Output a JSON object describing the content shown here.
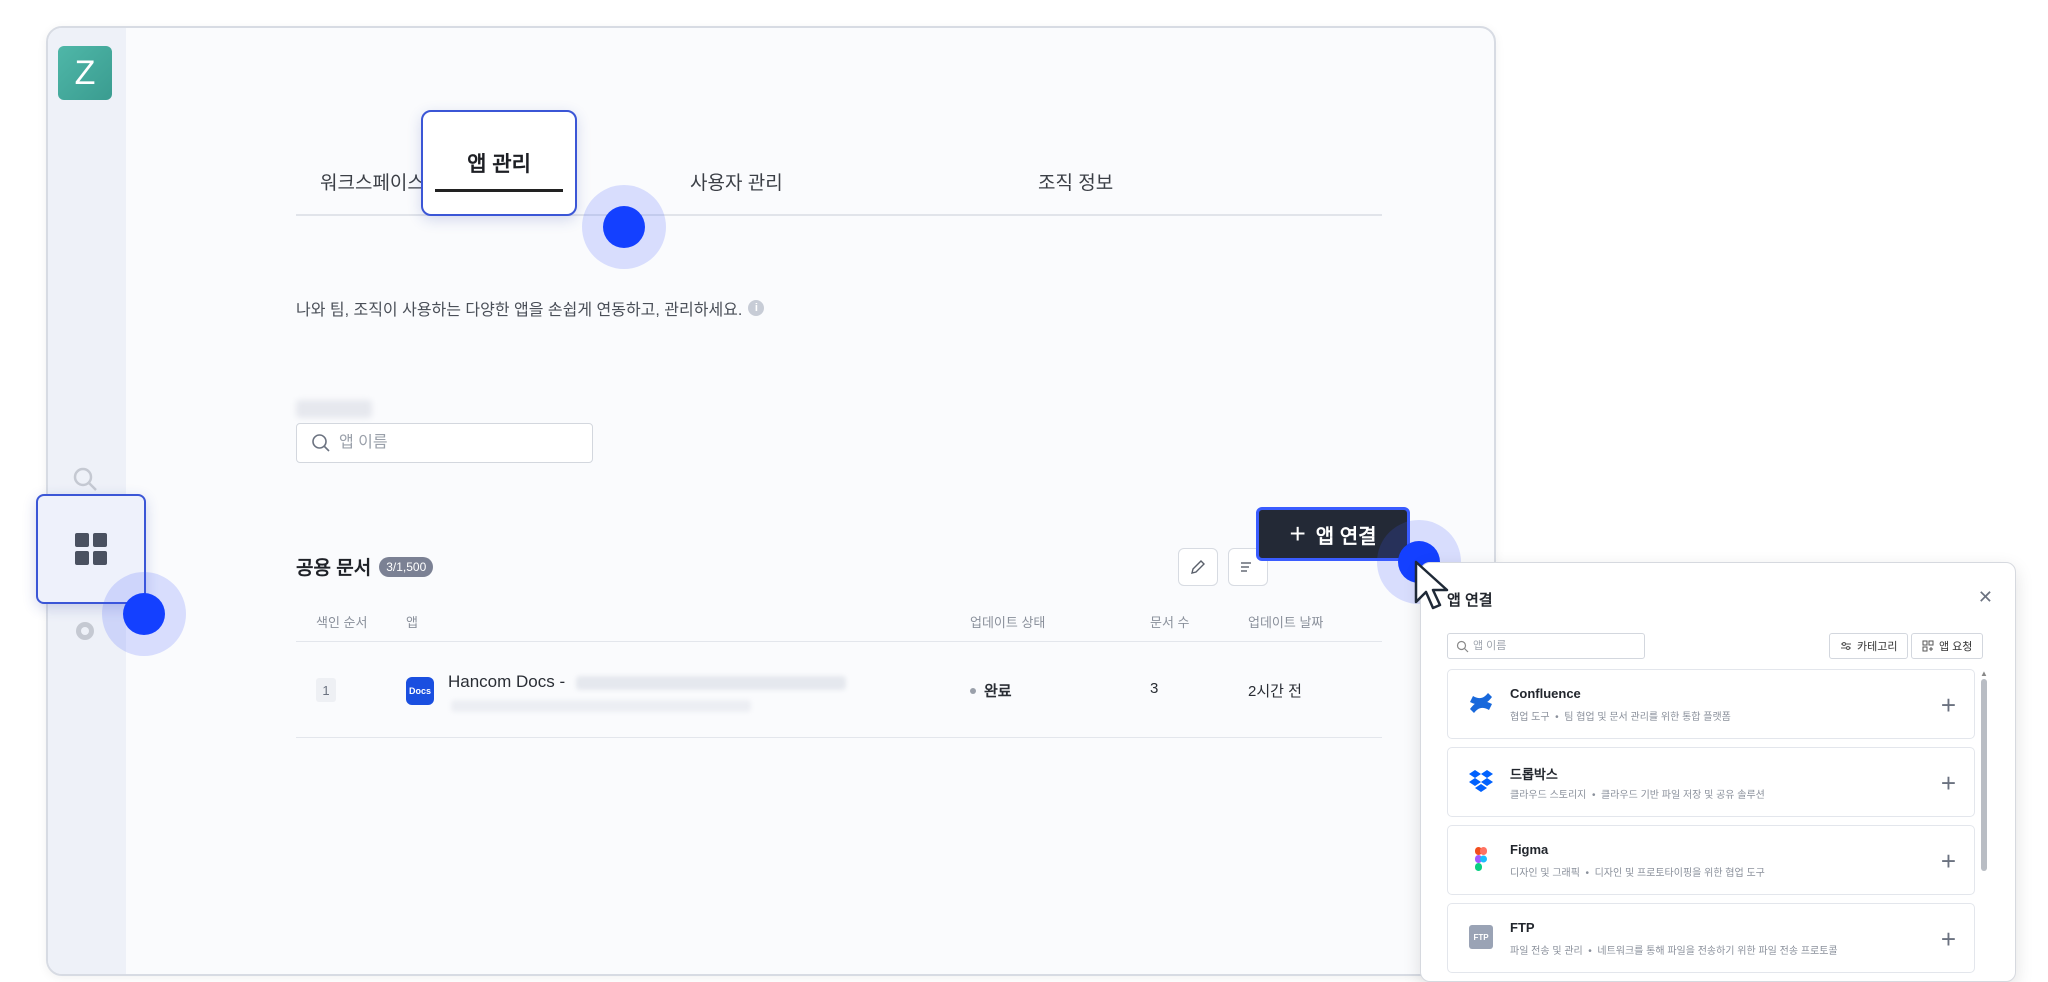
{
  "workspace_logo": "Z",
  "tabs": [
    {
      "label": "워크스페이스 관리"
    },
    {
      "label": "앱 관리"
    },
    {
      "label": "사용자 관리"
    },
    {
      "label": "조직 정보"
    }
  ],
  "description": "나와 팀, 조직이 사용하는 다양한 앱을 손쉽게 연동하고, 관리하세요.",
  "search": {
    "placeholder": "앱 이름"
  },
  "section": {
    "title": "공용 문서",
    "count": "3/1,500"
  },
  "connect_button": {
    "label": "앱 연결"
  },
  "table": {
    "headers": [
      "색인 순서",
      "앱",
      "업데이트 상태",
      "문서 수",
      "업데이트 날짜"
    ],
    "rows": [
      {
        "index": "1",
        "app_icon": "Docs",
        "app": "Hancom Docs -",
        "status": "완료",
        "docs": "3",
        "updated": "2시간 전"
      }
    ]
  },
  "panel": {
    "title": "앱 연결",
    "search_placeholder": "앱 이름",
    "category_label": "카테고리",
    "request_label": "앱 요청",
    "apps": [
      {
        "name": "Confluence",
        "category": "협업 도구",
        "desc": "팀 협업 및 문서 관리를 위한 통합 플랫폼",
        "icon": "confluence-icon",
        "color": "#1868db"
      },
      {
        "name": "드롭박스",
        "category": "클라우드 스토리지",
        "desc": "클라우드 기반 파일 저장 및 공유 솔루션",
        "icon": "dropbox-icon",
        "color": "#0061fe"
      },
      {
        "name": "Figma",
        "category": "디자인 및 그래픽",
        "desc": "디자인 및 프로토타이핑을 위한 협업 도구",
        "icon": "figma-icon",
        "color": "#f24e1e"
      },
      {
        "name": "FTP",
        "category": "파일 전송 및 관리",
        "desc": "네트워크를 통해 파일을 전송하기 위한 파일 전송 프로토콜",
        "icon": "ftp-icon",
        "icon_text": "FTP",
        "color": "#9aa3b5"
      }
    ]
  },
  "colors": {
    "accent": "#1440ff",
    "dark_button": "#232936",
    "rail": "#eef1f8"
  }
}
